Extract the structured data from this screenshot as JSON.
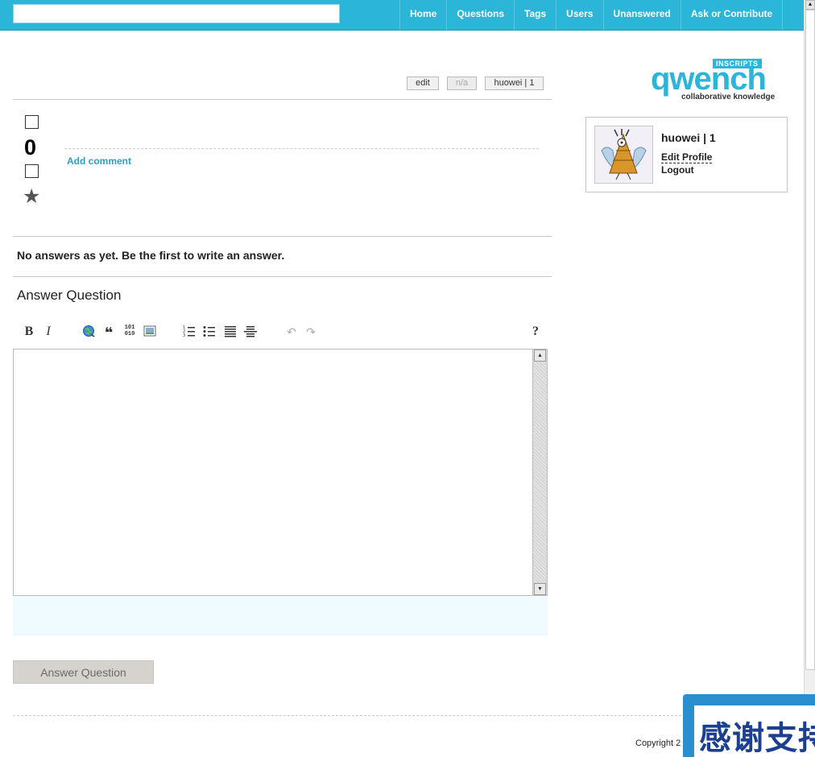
{
  "search": {
    "value": "",
    "placeholder": ""
  },
  "nav": {
    "items": [
      {
        "label": "Home"
      },
      {
        "label": "Questions"
      },
      {
        "label": "Tags"
      },
      {
        "label": "Users"
      },
      {
        "label": "Unanswered"
      },
      {
        "label": "Ask or Contribute"
      }
    ]
  },
  "question_actions": {
    "edit": "edit",
    "na": "n/a",
    "owner": "huowei | 1"
  },
  "vote": {
    "count": "0",
    "up_icon": "vote-up-box-icon",
    "down_icon": "vote-down-box-icon",
    "star": "★"
  },
  "comments": {
    "add_label": "Add comment"
  },
  "answers": {
    "empty_text": "No answers as yet. Be the first to write an answer."
  },
  "answer_form": {
    "heading": "Answer Question",
    "toolbar": {
      "bold": "B",
      "italic": "I",
      "quote": "❝",
      "code": "101\n010",
      "help": "?"
    },
    "textarea_value": "",
    "submit_label": "Answer Question"
  },
  "logo": {
    "badge": "INSCRIPTS",
    "word": "qwench",
    "tagline": "collaborative knowledge"
  },
  "user": {
    "name": "huowei | 1",
    "edit_profile": "Edit Profile",
    "logout": "Logout"
  },
  "footer": {
    "copyright": "Copyright 2"
  },
  "overlay": {
    "text": "感谢支持"
  },
  "colors": {
    "accent": "#2bb5d8",
    "link": "#2a9fbf",
    "preview_bg": "#effbff",
    "overlay": "#2a8fce"
  }
}
